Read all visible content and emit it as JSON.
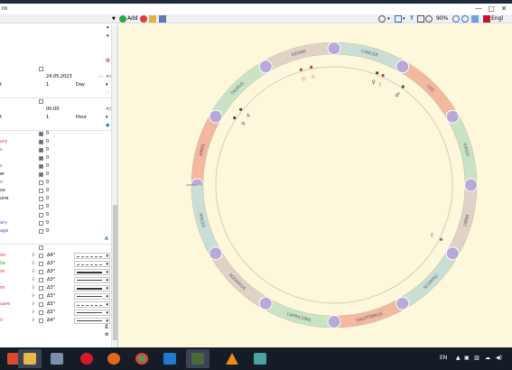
{
  "window": {
    "title": "ro",
    "minimize": "—",
    "maximize": "□",
    "close": "✕"
  },
  "toolbar": {
    "add_label": "Add",
    "zoom": "90%",
    "language": "Engl"
  },
  "left_panel": {
    "date": "24.05.2023",
    "step_value": "1",
    "step_unit": "Day",
    "time": "00:00",
    "time_step_value": "1",
    "time_step_unit": "Hour",
    "labels": {
      "row_step": "t",
      "row_time_step": "t",
      "mercury": "ury",
      "s1": "s",
      "s2": "s",
      "jupiter": "er",
      "saturn": "n",
      "uranus": "us",
      "neptune": "une",
      "asc_c": "ary",
      "ag": "age"
    },
    "counts": [
      "0",
      "0",
      "0",
      "0",
      "0",
      "0",
      "0",
      "0",
      "0",
      "0",
      "0",
      "0",
      "0"
    ],
    "aspects": [
      {
        "label": "on",
        "color": "#d33",
        "orb": "4°",
        "style": "dash"
      },
      {
        "label": "ile",
        "color": "#2a2",
        "orb": "3°",
        "style": "dash"
      },
      {
        "label": "re",
        "color": "#d33",
        "orb": "3°",
        "style": "thick"
      },
      {
        "label": "",
        "color": "#d33",
        "orb": "3°",
        "style": "solid"
      },
      {
        "label": "re",
        "color": "#d33",
        "orb": "3°",
        "style": "thick"
      },
      {
        "label": "",
        "color": "#d33",
        "orb": "3°",
        "style": "solid"
      },
      {
        "label": "uare",
        "color": "#d33",
        "orb": "3°",
        "style": "dash"
      },
      {
        "label": "",
        "color": "#d33",
        "orb": "3°",
        "style": "solid"
      },
      {
        "label": "n",
        "color": "#d33",
        "orb": "4°",
        "style": "solid"
      }
    ]
  },
  "chart": {
    "signs": [
      "ARIES",
      "TAURUS",
      "GEMINI",
      "CANCER",
      "LEO",
      "VIRGO",
      "LIBRA",
      "SCORPIO",
      "SAGITTARIUS",
      "CAPRICORN",
      "AQUARIUS",
      "PISCES"
    ],
    "element_colors": {
      "fire": "#f4b7a0",
      "earth": "#c9e4c5",
      "air": "#e1d2c8",
      "water": "#c9dfd5"
    },
    "background": "#fdf8dc"
  },
  "taskbar": {
    "language": "EN",
    "apps": [
      "start",
      "file-explorer",
      "media",
      "opera",
      "firefox",
      "chrome",
      "remote",
      "stellarium",
      "vlc",
      "file-manager"
    ]
  }
}
